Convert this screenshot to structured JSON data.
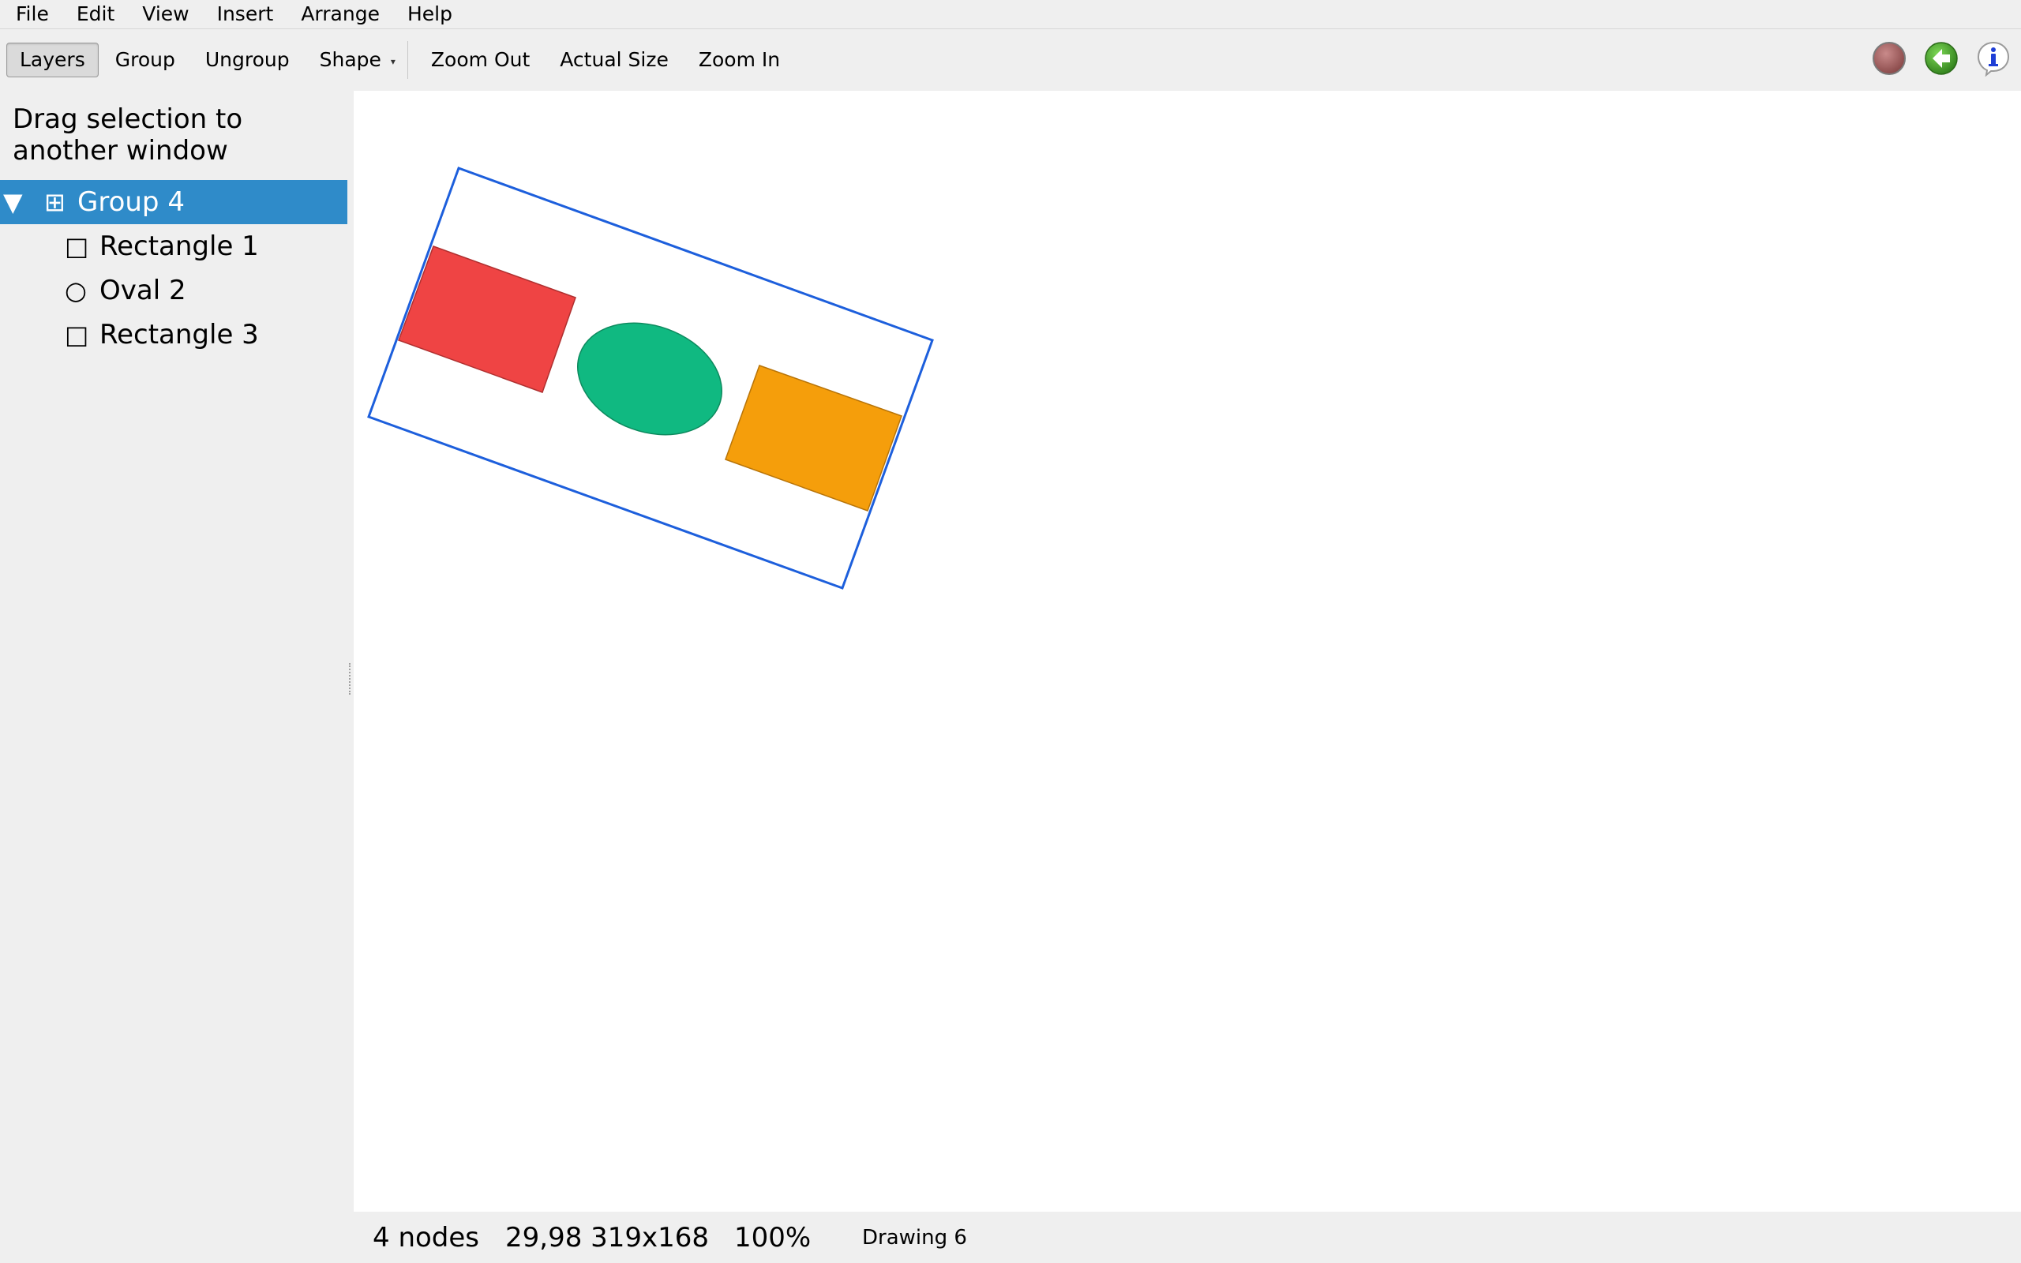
{
  "menubar": {
    "items": [
      "File",
      "Edit",
      "View",
      "Insert",
      "Arrange",
      "Help"
    ]
  },
  "toolbar": {
    "layers": "Layers",
    "group": "Group",
    "ungroup": "Ungroup",
    "shape": "Shape",
    "zoom_out": "Zoom Out",
    "actual_size": "Actual Size",
    "zoom_in": "Zoom In",
    "right_icons": [
      "record-icon",
      "back-arrow-icon",
      "info-icon"
    ]
  },
  "sidebar": {
    "hint": "Drag selection to another window",
    "tree": [
      {
        "label": "Group 4",
        "kind": "group",
        "expanded": true,
        "selected": true
      },
      {
        "label": "Rectangle 1",
        "kind": "rectangle"
      },
      {
        "label": "Oval 2",
        "kind": "oval"
      },
      {
        "label": "Rectangle 3",
        "kind": "rectangle"
      }
    ]
  },
  "canvas": {
    "shapes": [
      {
        "name": "Rectangle 1",
        "fill": "#ef4444"
      },
      {
        "name": "Oval 2",
        "fill": "#10b981"
      },
      {
        "name": "Rectangle 3",
        "fill": "#f59e0b"
      }
    ],
    "selection_color": "#1d5fdc"
  },
  "statusbar": {
    "nodes": "4 nodes",
    "geometry": "29,98 319x168",
    "zoom": "100%",
    "document": "Drawing 6"
  },
  "colors": {
    "selection_bg": "#2f8bc9",
    "chrome_bg": "#efefef"
  }
}
